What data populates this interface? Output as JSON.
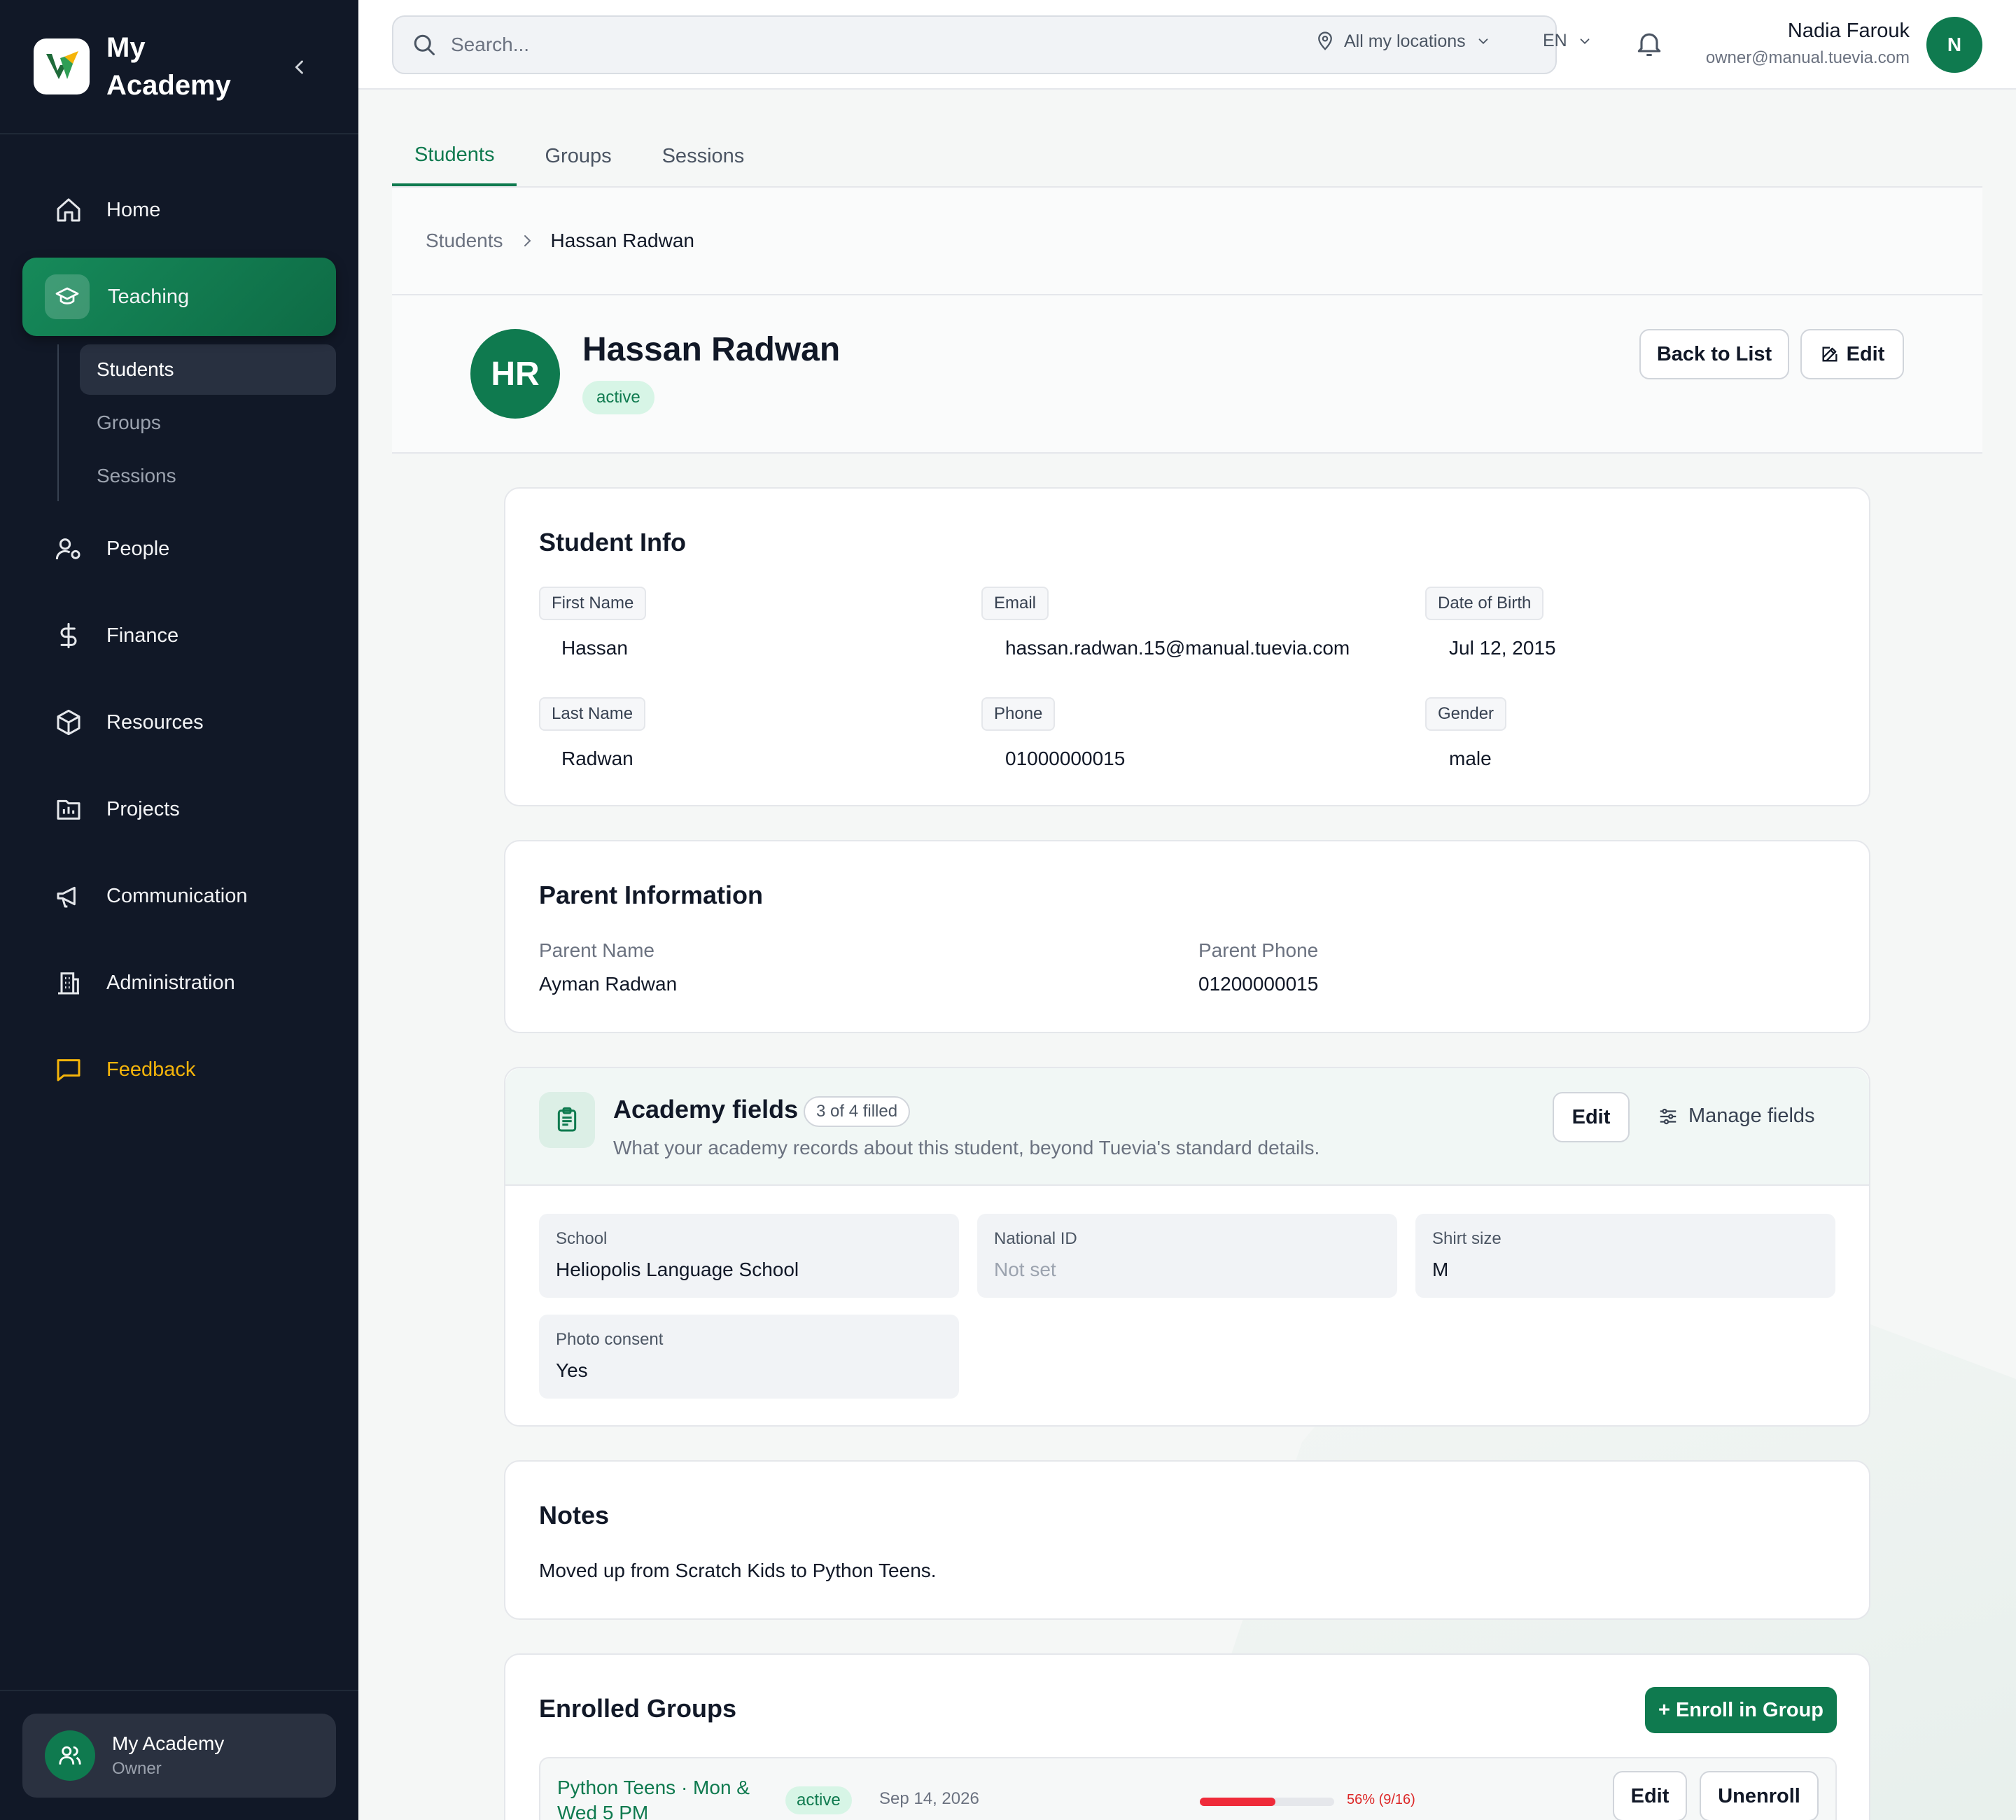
{
  "app": {
    "name": "My Academy"
  },
  "sidebar": {
    "items": [
      {
        "label": "Home"
      },
      {
        "label": "Teaching"
      },
      {
        "label": "People"
      },
      {
        "label": "Finance"
      },
      {
        "label": "Resources"
      },
      {
        "label": "Projects"
      },
      {
        "label": "Communication"
      },
      {
        "label": "Administration"
      },
      {
        "label": "Feedback"
      }
    ],
    "teaching_sub": [
      {
        "label": "Students"
      },
      {
        "label": "Groups"
      },
      {
        "label": "Sessions"
      }
    ],
    "org": {
      "name": "My Academy",
      "role": "Owner"
    }
  },
  "topbar": {
    "search_placeholder": "Search...",
    "location": "All my locations",
    "language": "EN",
    "user_name": "Nadia Farouk",
    "user_email": "owner@manual.tuevia.com",
    "user_initial": "N"
  },
  "tabs": [
    {
      "label": "Students"
    },
    {
      "label": "Groups"
    },
    {
      "label": "Sessions"
    }
  ],
  "breadcrumb": {
    "parent": "Students",
    "current": "Hassan Radwan"
  },
  "student": {
    "initials": "HR",
    "name": "Hassan Radwan",
    "status": "active",
    "back_label": "Back to List",
    "edit_label": "Edit"
  },
  "info": {
    "title": "Student Info",
    "first_name_label": "First Name",
    "first_name": "Hassan",
    "email_label": "Email",
    "email": "hassan.radwan.15@manual.tuevia.com",
    "dob_label": "Date of Birth",
    "dob": "Jul 12, 2015",
    "last_name_label": "Last Name",
    "last_name": "Radwan",
    "phone_label": "Phone",
    "phone": "01000000015",
    "gender_label": "Gender",
    "gender": "male"
  },
  "parent": {
    "title": "Parent Information",
    "name_label": "Parent Name",
    "name": "Ayman Radwan",
    "phone_label": "Parent Phone",
    "phone": "01200000015"
  },
  "academy_fields": {
    "title": "Academy fields",
    "count": "3 of 4 filled",
    "subtitle": "What your academy records about this student, beyond Tuevia's standard details.",
    "edit_label": "Edit",
    "manage_label": "Manage fields",
    "fields": [
      {
        "label": "School",
        "value": "Heliopolis Language School"
      },
      {
        "label": "National ID",
        "value": "Not set"
      },
      {
        "label": "Shirt size",
        "value": "M"
      },
      {
        "label": "Photo consent",
        "value": "Yes"
      }
    ]
  },
  "notes": {
    "title": "Notes",
    "text": "Moved up from Scratch Kids to Python Teens."
  },
  "enrolled": {
    "title": "Enrolled Groups",
    "enroll_label": "+ Enroll in Group",
    "rows": [
      {
        "name_line1": "Python Teens · Mon &",
        "name_line2": "Wed 5 PM",
        "status": "active",
        "date": "Sep 14, 2026",
        "progress": 0.56,
        "progress_label": "56% (9/16)",
        "edit_label": "Edit",
        "unenroll_label": "Unenroll"
      }
    ]
  },
  "colors": {
    "brand": "#0f7a4f",
    "sidebar": "#111827",
    "feedback": "#f5b40a",
    "progress": "#ef2b3a"
  }
}
